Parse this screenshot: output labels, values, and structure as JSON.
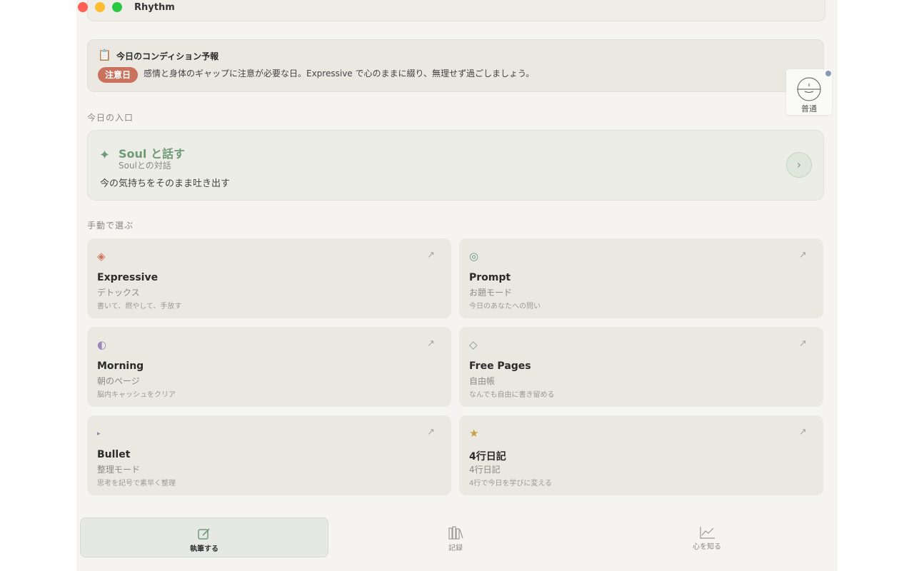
{
  "app": {
    "title": "Rhythm"
  },
  "forecast": {
    "icon": "clipboard-icon",
    "title": "今日のコンディション予報",
    "badge": "注意日",
    "description": "感情と身体のギャップに注意が必要な日。Expressive で心のままに綴り、無理せず過ごしましょう。",
    "badge_color": "#c9735f"
  },
  "mood": {
    "label": "普通",
    "icon": "mood-dial-icon"
  },
  "entry_section": {
    "label": "今日の入口",
    "card": {
      "title": "Soul と話す",
      "subtitle": "Soulとの対話",
      "description": "今の気持ちをそのまま吐き出す",
      "accent": "#6f9a78"
    }
  },
  "manual_section": {
    "label": "手動で選ぶ",
    "cards": [
      {
        "icon": "diamond-icon",
        "name": "Expressive",
        "sub": "デトックス",
        "desc": "書いて、燃やして、手放す",
        "color": "#c9735f"
      },
      {
        "icon": "target-icon",
        "name": "Prompt",
        "sub": "お題モード",
        "desc": "今日のあなたへの問い",
        "color": "#6f9a78"
      },
      {
        "icon": "half-moon-icon",
        "name": "Morning",
        "sub": "朝のページ",
        "desc": "脳内キャッシュをクリア",
        "color": "#9b86b8"
      },
      {
        "icon": "outline-diamond-icon",
        "name": "Free Pages",
        "sub": "自由帳",
        "desc": "なんでも自由に書き留める",
        "color": "#7a9a86"
      },
      {
        "icon": "bullet-icon",
        "name": "Bullet",
        "sub": "整理モード",
        "desc": "思考を記号で素早く整理",
        "color": "#7a8aa0"
      },
      {
        "icon": "star-icon",
        "name": "4行日記",
        "sub": "4行日記",
        "desc": "4行で今日を学びに変える",
        "color": "#c9a04a"
      }
    ]
  },
  "tabs": [
    {
      "label": "執筆する",
      "icon": "compose-icon",
      "active": true
    },
    {
      "label": "記録",
      "icon": "library-icon",
      "active": false
    },
    {
      "label": "心を知る",
      "icon": "chart-icon",
      "active": false
    }
  ]
}
